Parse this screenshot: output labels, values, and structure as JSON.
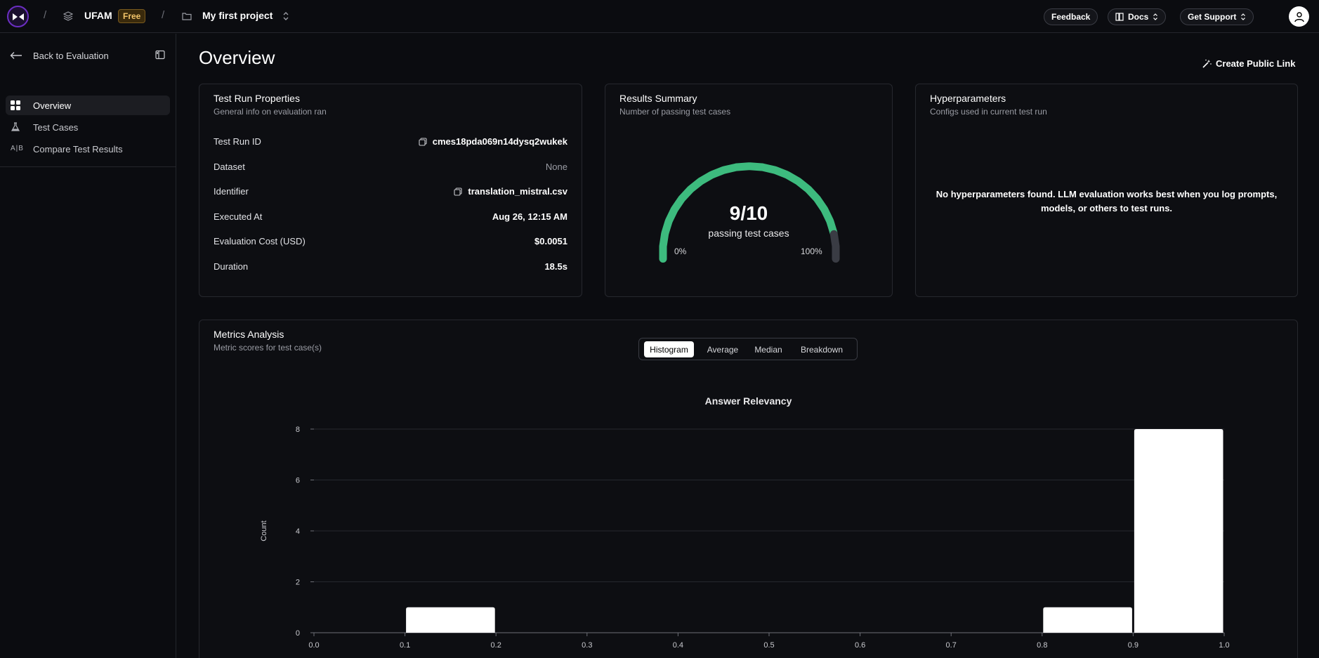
{
  "topbar": {
    "org": "UFAM",
    "plan_badge": "Free",
    "project": "My first project",
    "feedback": "Feedback",
    "docs": "Docs",
    "support": "Get Support"
  },
  "sidebar": {
    "back": "Back to Evaluation",
    "items": [
      {
        "label": "Overview",
        "icon": "grid-icon"
      },
      {
        "label": "Test Cases",
        "icon": "flask-icon"
      },
      {
        "label": "Compare Test Results",
        "icon": "ab-icon",
        "icon_text": "A|B"
      }
    ]
  },
  "main": {
    "title": "Overview",
    "public_link": "Create Public Link"
  },
  "properties": {
    "title": "Test Run Properties",
    "subtitle": "General info on evaluation ran",
    "rows": [
      {
        "key": "Test Run ID",
        "value": "cmes18pda069n14dysq2wukek"
      },
      {
        "key": "Dataset",
        "value": "None"
      },
      {
        "key": "Identifier",
        "value": "translation_mistral.csv"
      },
      {
        "key": "Executed At",
        "value": "Aug 26, 12:15 AM"
      },
      {
        "key": "Evaluation Cost (USD)",
        "value": "$0.0051"
      },
      {
        "key": "Duration",
        "value": "18.5s"
      }
    ]
  },
  "summary": {
    "title": "Results Summary",
    "subtitle": "Number of passing test cases",
    "score": "9/10",
    "caption": "passing test cases",
    "min_label": "0%",
    "max_label": "100%",
    "passing": 9,
    "total": 10,
    "color_pass": "#3dbb7e",
    "color_rest": "#3a3c44"
  },
  "hyper": {
    "title": "Hyperparameters",
    "subtitle": "Configs used in current test run",
    "message": "No hyperparameters found. LLM evaluation works best when you log prompts, models, or others to test runs."
  },
  "metrics": {
    "title": "Metrics Analysis",
    "subtitle": "Metric scores for test case(s)",
    "tabs": [
      "Histogram",
      "Average",
      "Median",
      "Breakdown"
    ],
    "active_tab": "Histogram"
  },
  "chart_data": {
    "type": "bar",
    "title": "Answer Relevancy",
    "xlabel": "",
    "ylabel": "Count",
    "bins": [
      {
        "start": 0.1,
        "end": 0.2,
        "count": 1
      },
      {
        "start": 0.8,
        "end": 0.9,
        "count": 1
      },
      {
        "start": 0.9,
        "end": 1.0,
        "count": 8
      }
    ],
    "xticks": [
      "0.0",
      "0.1",
      "0.2",
      "0.3",
      "0.4",
      "0.5",
      "0.6",
      "0.7",
      "0.8",
      "0.9",
      "1.0"
    ],
    "yticks": [
      "0",
      "2",
      "4",
      "6",
      "8"
    ],
    "xlim": [
      0,
      1
    ],
    "ylim": [
      0,
      8
    ],
    "grid": true,
    "bar_color": "#ffffff"
  }
}
